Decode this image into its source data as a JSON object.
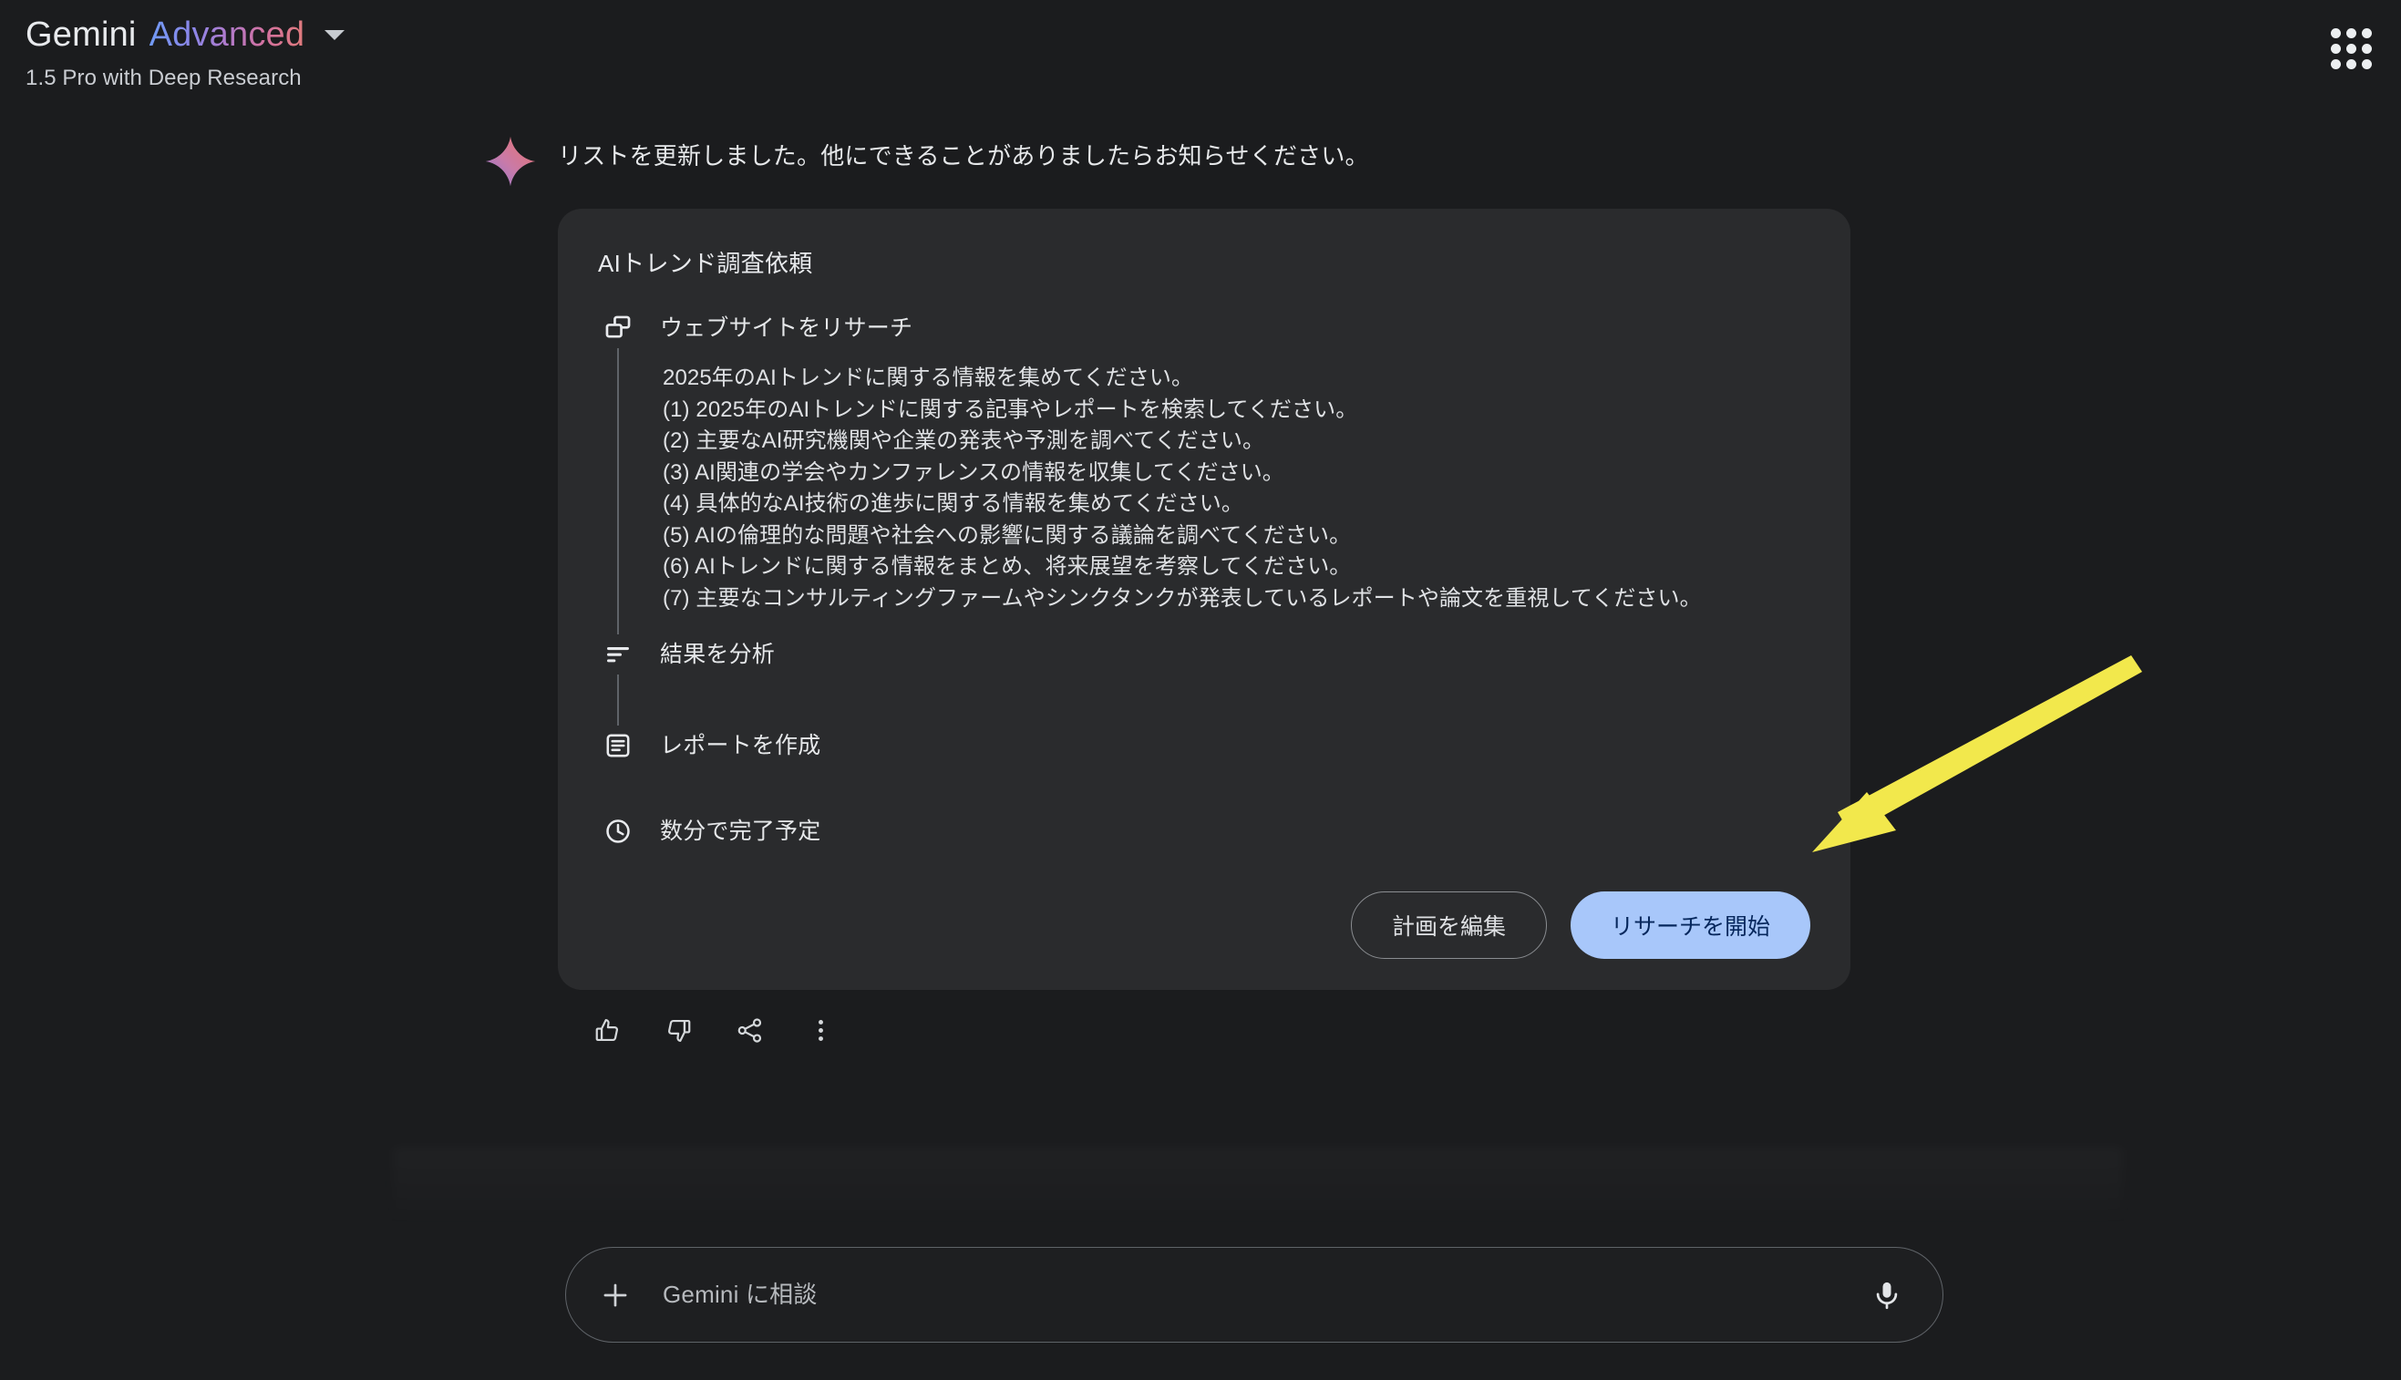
{
  "header": {
    "brand_word_1": "Gemini",
    "brand_word_2": "Advanced",
    "brand_gradient_start": "#6f9bf5",
    "brand_gradient_end": "#e07b7b",
    "subtitle": "1.5 Pro with Deep Research",
    "model_selector_icon": "chevron-down-icon",
    "apps_grid_icon": "apps-grid-icon"
  },
  "assistant": {
    "avatar_icon": "gemini-sparkle-icon",
    "message": "リストを更新しました。他にできることがありましたらお知らせください。"
  },
  "plan_card": {
    "title": "AIトレンド調査依頼",
    "background": "#2a2b2d",
    "steps": [
      {
        "icon": "web-windows-icon",
        "label": "ウェブサイトをリサーチ"
      },
      {
        "icon": "analyze-bars-icon",
        "label": "結果を分析"
      },
      {
        "icon": "document-article-icon",
        "label": "レポートを作成"
      },
      {
        "icon": "clock-icon",
        "label": "数分で完了予定"
      }
    ],
    "research_detail": [
      "2025年のAIトレンドに関する情報を集めてください。",
      "(1) 2025年のAIトレンドに関する記事やレポートを検索してください。",
      "(2) 主要なAI研究機関や企業の発表や予測を調べてください。",
      "(3) AI関連の学会やカンファレンスの情報を収集してください。",
      "(4) 具体的なAI技術の進歩に関する情報を集めてください。",
      "(5) AIの倫理的な問題や社会への影響に関する議論を調べてください。",
      "(6) AIトレンドに関する情報をまとめ、将来展望を考察してください。",
      "(7) 主要なコンサルティングファームやシンクタンクが発表しているレポートや論文を重視してください。"
    ],
    "edit_plan_label": "計画を編集",
    "start_research_label": "リサーチを開始",
    "start_research_bg": "#a8c7fa",
    "start_research_text_color": "#06275c"
  },
  "message_actions": [
    {
      "icon": "thumb-up-icon"
    },
    {
      "icon": "thumb-down-icon"
    },
    {
      "icon": "share-icon"
    },
    {
      "icon": "more-vert-icon"
    }
  ],
  "composer": {
    "plus_icon": "plus-icon",
    "placeholder": "Gemini に相談",
    "value": "",
    "mic_icon": "microphone-icon"
  },
  "annotation": {
    "arrow_color": "#f2e84c",
    "points_to": "リサーチを開始"
  }
}
